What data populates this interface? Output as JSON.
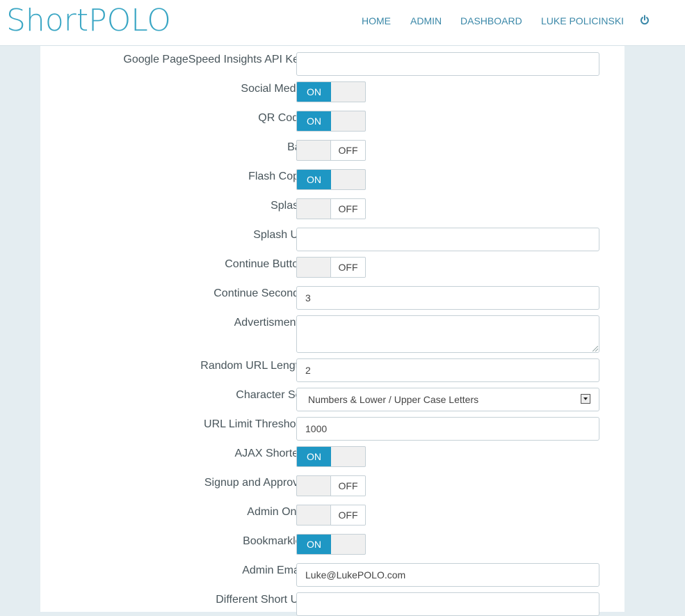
{
  "header": {
    "logo": "ShortPOLO",
    "nav": {
      "home": "HOME",
      "admin": "ADMIN",
      "dashboard": "DASHBOARD",
      "user": "LUKE POLICINSKI"
    },
    "power_icon": "power-icon"
  },
  "help_glyph": "?",
  "settings": {
    "pagespeed_key": {
      "label": "Google PageSpeed Insights API Key",
      "value": ""
    },
    "social_media": {
      "label": "Social Media",
      "state": "ON"
    },
    "qr_code": {
      "label": "QR Code",
      "state": "ON"
    },
    "bar": {
      "label": "Bar",
      "state": "OFF"
    },
    "flash_copy": {
      "label": "Flash Copy",
      "state": "ON"
    },
    "splash": {
      "label": "Splash",
      "state": "OFF"
    },
    "splash_url": {
      "label": "Splash Url",
      "value": ""
    },
    "continue_button": {
      "label": "Continue Button",
      "state": "OFF"
    },
    "continue_seconds": {
      "label": "Continue Seconds",
      "value": "3"
    },
    "advertisments": {
      "label": "Advertisments",
      "value": ""
    },
    "random_url_length": {
      "label": "Random URL Length",
      "value": "2"
    },
    "character_set": {
      "label": "Character Set",
      "value": "Numbers & Lower / Upper Case Letters"
    },
    "url_limit_threshold": {
      "label": "URL Limit Threshold",
      "value": "1000"
    },
    "ajax_shorten": {
      "label": "AJAX Shorten",
      "state": "ON"
    },
    "signup_approve": {
      "label": "Signup and Approve",
      "state": "OFF"
    },
    "admin_only": {
      "label": "Admin Only",
      "state": "OFF"
    },
    "bookmarklet": {
      "label": "Bookmarklet",
      "state": "ON"
    },
    "admin_email": {
      "label": "Admin Email",
      "value": "Luke@LukePOLO.com"
    },
    "different_short_url": {
      "label": "Different Short Url",
      "value": ""
    }
  },
  "colors": {
    "brand": "#3aa6c4",
    "toggle_on": "#1e97c4",
    "nav_link": "#3b88a8",
    "page_bg": "#e4edf1"
  }
}
